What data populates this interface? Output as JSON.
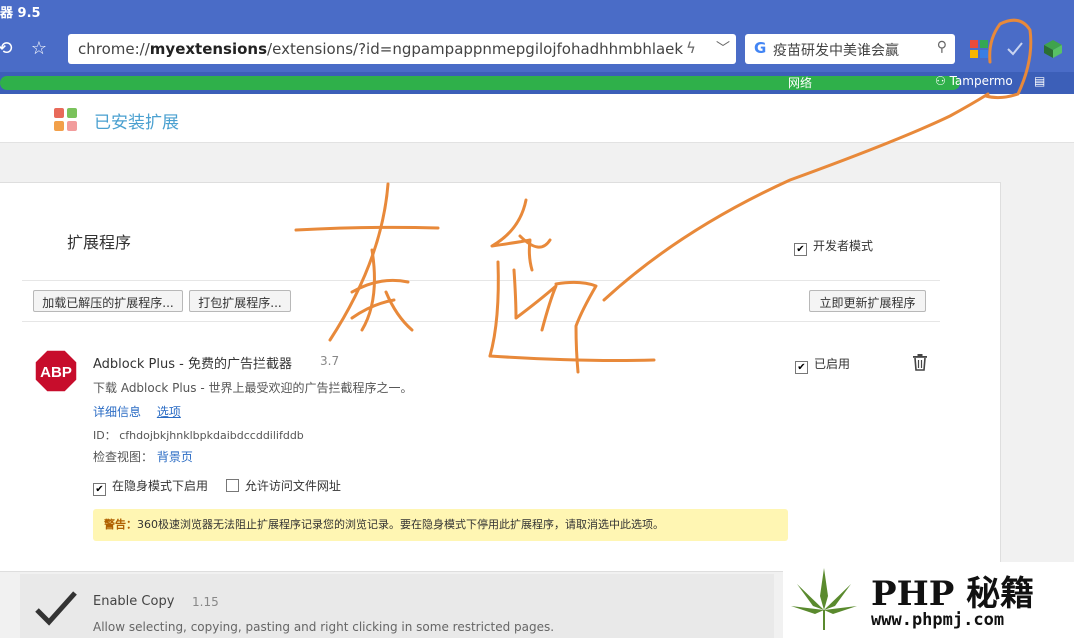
{
  "browser": {
    "title": "器 9.5",
    "url_prefix": "chrome://",
    "url_host": "myextensions",
    "url_rest": "/extensions/?id=ngpampappnmepgilojfohadhhmbhlaek",
    "search_text": "疫苗研发中美谁会赢",
    "bookmark_visible": "Tampermo",
    "bookmark_partial": "网络"
  },
  "page": {
    "heading": "已安装扩展",
    "section_title": "扩展程序",
    "developer_mode_label": "开发者模式",
    "buttons": {
      "load_unpacked": "加载已解压的扩展程序...",
      "pack": "打包扩展程序...",
      "update_now": "立即更新扩展程序"
    }
  },
  "extensions": [
    {
      "name": "Adblock Plus - 免费的广告拦截器",
      "version": "3.7",
      "description": "下载 Adblock Plus - 世界上最受欢迎的广告拦截程序之一。",
      "details_link": "详细信息",
      "options_link": "选项",
      "id_label": "ID：",
      "id_value": "cfhdojbkjhnklbpkdaibdccddilifddb",
      "inspect_label": "检查视图：",
      "inspect_link": "背景页",
      "incognito_label": "在隐身模式下启用",
      "file_access_label": "允许访问文件网址",
      "enabled_label": "已启用",
      "warning_label": "警告：",
      "warning_text": "360极速浏览器无法阻止扩展程序记录您的浏览记录。要在隐身模式下停用此扩展程序，请取消选中此选项。",
      "icon_text": "ABP"
    },
    {
      "name": "Enable Copy",
      "version": "1.15",
      "description": "Allow selecting, copying, pasting and right clicking in some restricted pages."
    }
  ],
  "watermark": {
    "title": "PHP 秘籍",
    "url": "www.phpmj.com"
  },
  "colors": {
    "titlebar": "#4a6cc7",
    "bookmark_scribble": "#2fb04a",
    "annotation": "#e8893a",
    "warning_bg": "#fff6b3"
  }
}
